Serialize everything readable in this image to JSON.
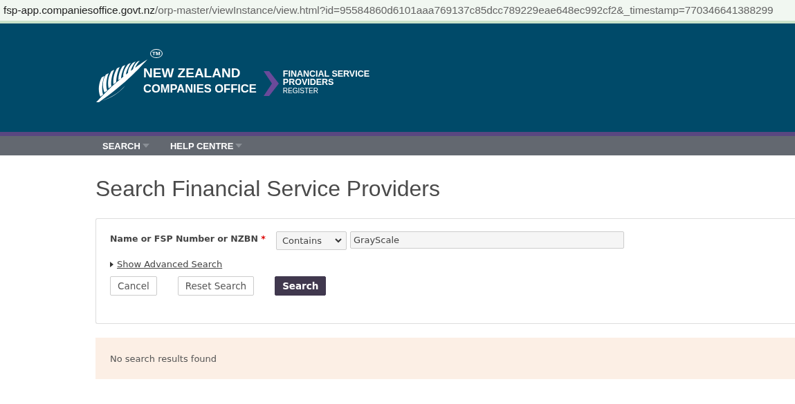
{
  "address_bar": {
    "host": "fsp-app.companiesoffice.govt.nz",
    "path": "/orp-master/viewInstance/view.html?id=95584860d6101aaa769137c85dcc789229eae648ec992cf2&_timestamp=770346641388299"
  },
  "logo": {
    "line_1": "NEW ZEALAND",
    "line_2": "COMPANIES OFFICE",
    "mark": "TM",
    "register_line_1": "FINANCIAL SERVICE",
    "register_line_2": "PROVIDERS",
    "register_line_3": "REGISTER"
  },
  "nav": [
    {
      "label": "SEARCH"
    },
    {
      "label": "HELP CENTRE"
    }
  ],
  "page_title": "Search Financial Service Providers",
  "form": {
    "label": "Name or FSP Number or NZBN",
    "required_mark": "*",
    "match": "Contains",
    "value": "GrayScale",
    "advanced_link": "Show Advanced Search",
    "expanded": false,
    "buttons": [
      {
        "label": "Cancel",
        "kind": "secondary"
      },
      {
        "label": "Reset Search",
        "kind": "secondary"
      },
      {
        "label": "Search",
        "kind": "primary"
      }
    ]
  },
  "notice": "No search results found"
}
